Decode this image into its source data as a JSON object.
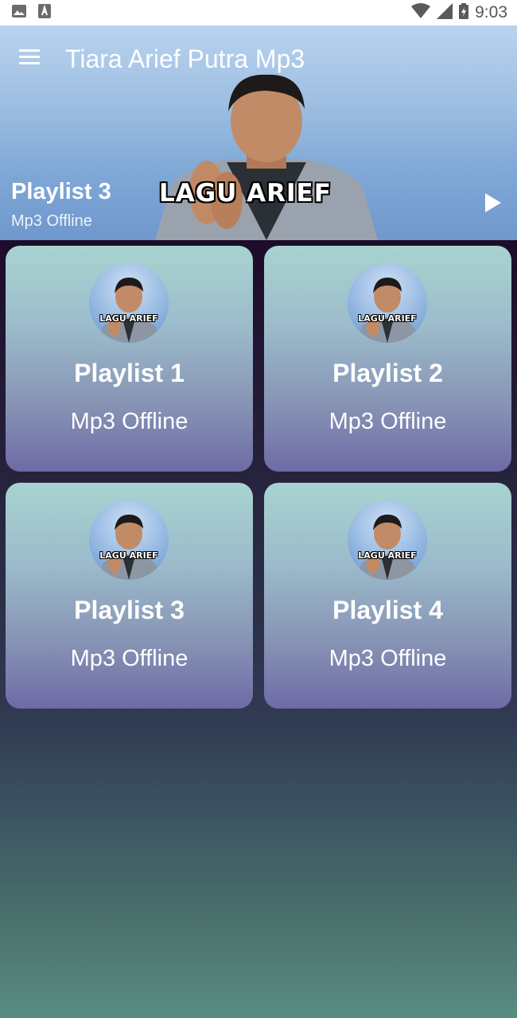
{
  "status_bar": {
    "time": "9:03",
    "icons": [
      "image-icon",
      "app-store-icon",
      "wifi-icon",
      "signal-icon",
      "battery-icon"
    ]
  },
  "header": {
    "title": "Tiara Arief Putra Mp3",
    "hero_text": "LAGU ARIEF",
    "now_playing": {
      "title": "Playlist 3",
      "subtitle": "Mp3 Offline"
    }
  },
  "cards": [
    {
      "title": "Playlist 1",
      "subtitle": "Mp3 Offline",
      "avatar_text": "LAGU ARIEF"
    },
    {
      "title": "Playlist 2",
      "subtitle": "Mp3 Offline",
      "avatar_text": "LAGU ARIEF"
    },
    {
      "title": "Playlist 3",
      "subtitle": "Mp3 Offline",
      "avatar_text": "LAGU ARIEF"
    },
    {
      "title": "Playlist 4",
      "subtitle": "Mp3 Offline",
      "avatar_text": "LAGU ARIEF"
    }
  ],
  "colors": {
    "header_bg": "#9fbfe2",
    "card_top": "#a8d3d0",
    "card_bottom": "#6e6aa6",
    "page_bg_top": "#1d0b2a",
    "page_bg_bottom": "#5a8c82"
  }
}
